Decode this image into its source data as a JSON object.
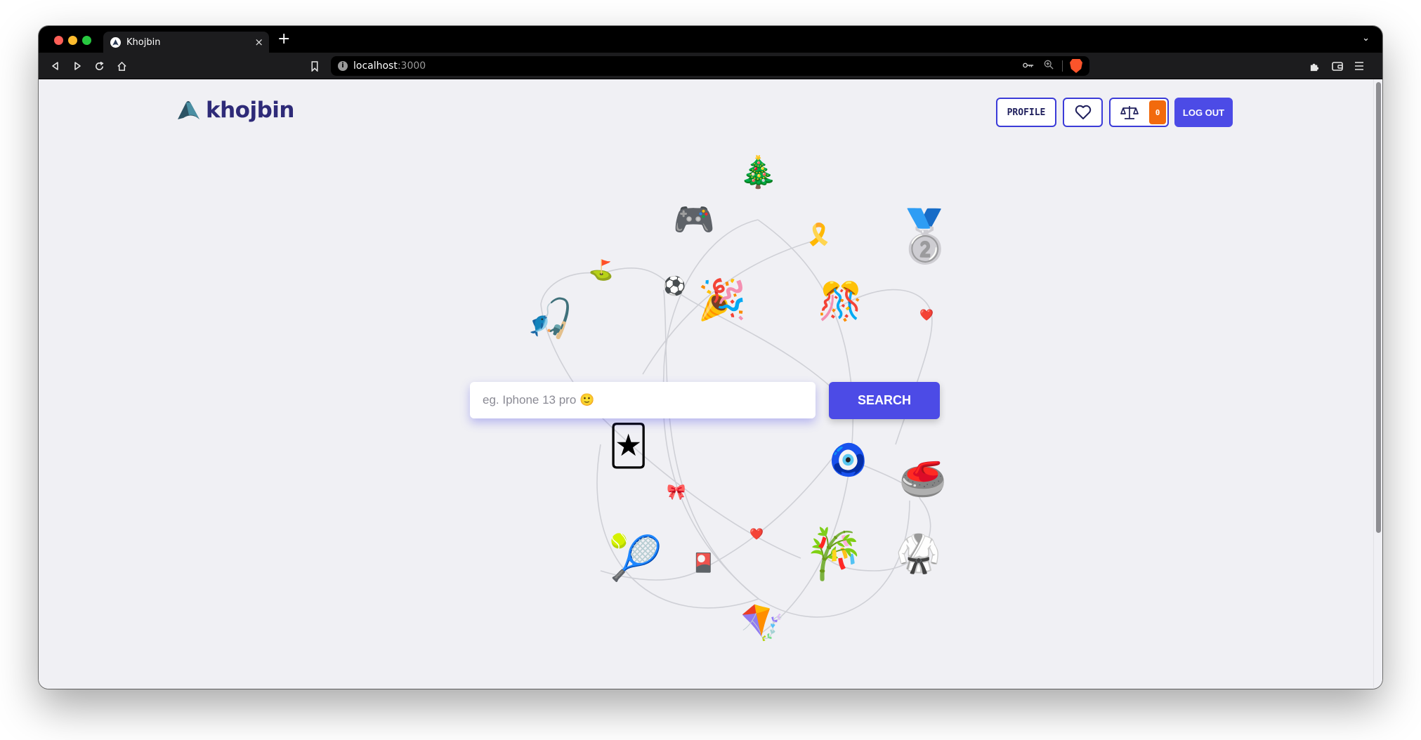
{
  "browser": {
    "tab_title": "Khojbin",
    "new_tab_symbol": "+",
    "close_symbol": "×",
    "tab_list_symbol": "⌄",
    "url_host": "localhost",
    "url_port": ":3000"
  },
  "header": {
    "logo_text": "khojbin",
    "profile_label": "PROFILE",
    "compare_count": "0",
    "logout_label": "LOG OUT"
  },
  "search": {
    "placeholder": "eg. Iphone 13 pro 🙂",
    "button_label": "SEARCH"
  },
  "decor_emojis": {
    "tree": "🎄",
    "gamepad": "🎮",
    "ribbon": "🎗️",
    "medal": "🥈",
    "golf": "⛳",
    "soccer": "⚽",
    "party_popper": "🎉",
    "confetti_ball": "🎊",
    "fishing": "🎣",
    "heart_small": "❤️",
    "joker": "🃏",
    "nazar": "🧿",
    "curling": "🥌",
    "bow": "🎀",
    "heart_mid": "❤️",
    "tennis": "🎾",
    "stamp": "🎴",
    "bamboo": "🎋",
    "martial_arts": "🥋",
    "kite": "🪁"
  }
}
